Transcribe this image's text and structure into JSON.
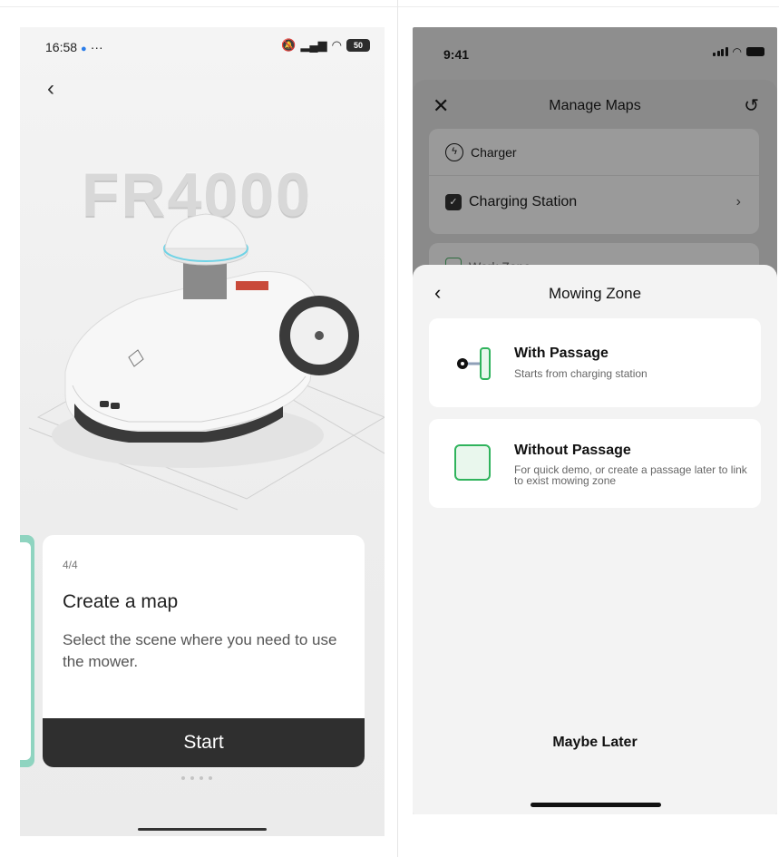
{
  "left": {
    "status_time": "16:58",
    "status_dots": "···",
    "battery": "50",
    "model": "FR4000",
    "step": "4/4",
    "title": "Create a map",
    "description": "Select the scene where you need to use the mower.",
    "start_label": "Start"
  },
  "right": {
    "status_time": "9:41",
    "header_title": "Manage Maps",
    "charger_label": "Charger",
    "station_label": "Charging Station",
    "work_zone_label": "Work Zone",
    "sheet_title": "Mowing Zone",
    "options": [
      {
        "title": "With Passage",
        "subtitle": "Starts from charging station"
      },
      {
        "title": "Without Passage",
        "subtitle": "For quick demo, or create a passage later to link to exist mowing zone"
      }
    ],
    "maybe_later": "Maybe Later"
  },
  "colors": {
    "accent_green": "#2fb35c",
    "side_tab_teal": "#8fd4c0",
    "dark_button": "#2f2f2f"
  }
}
